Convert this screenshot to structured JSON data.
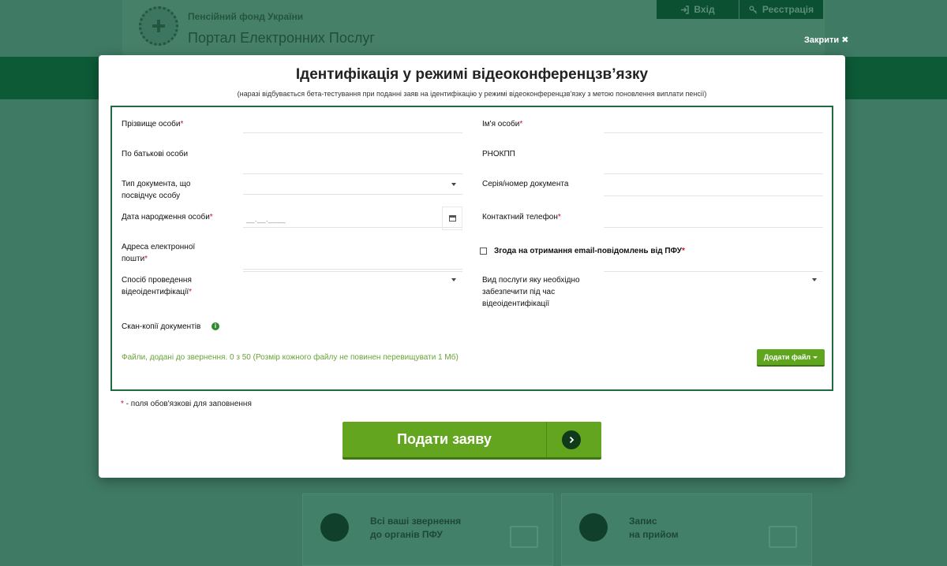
{
  "background": {
    "org_name": "Пенсійний фонд України",
    "portal_name": "Портал Електронних Послуг",
    "login_label": "Вхід",
    "register_label": "Реєстрація",
    "close_label": "Закрити",
    "cards": [
      {
        "line1": "Всі ваші звернення",
        "line2": "до органів ПФУ"
      },
      {
        "line1": "Запис",
        "line2": "на прийом"
      }
    ]
  },
  "modal": {
    "title": "Ідентифікація у режимі відеоконференцзв’язку",
    "subtitle": "(наразі відбувається бета-тестування при поданні заяв на ідентифікацію у режимі відеоконференцзв'язку з метою поновлення виплати пенсії)",
    "fields": {
      "surname_label": "Прізвище особи",
      "name_label": "Ім'я особи",
      "patronymic_label": "По батькові особи",
      "rnokpp_label": "РНОКПП",
      "doc_type_label_1": "Тип документа, що",
      "doc_type_label_2": "посвідчує особу",
      "doc_number_label": "Серія/номер документа",
      "birth_date_label": "Дата народження особи",
      "birth_date_placeholder": "__.__.____",
      "phone_label": "Контактний телефон",
      "email_label_1": "Адреса електронної",
      "email_label_2": "пошти",
      "consent_label": "Згода на отримання email-повідомлень від ПФУ",
      "method_label_1": "Спосіб проведення",
      "method_label_2": "відеоідентифікації",
      "service_label_1": "Вид послуги яку необхідно",
      "service_label_2": "забезпечити під час",
      "service_label_3": "відеоідентифікації",
      "scans_label": "Скан-копії документів"
    },
    "required_mark": "*",
    "files_text": "Файли, додані до звернення. 0 з 50 (Розмір кожного файлу не повинен перевищувати 1 Мб)",
    "add_file_label": "Додати файл",
    "required_note": "- поля обов'язкові для заповнення",
    "submit_label": "Подати заяву"
  },
  "colors": {
    "brand_green": "#1d6b3e",
    "button_green": "#63a51f",
    "required_red": "#c8102e"
  }
}
